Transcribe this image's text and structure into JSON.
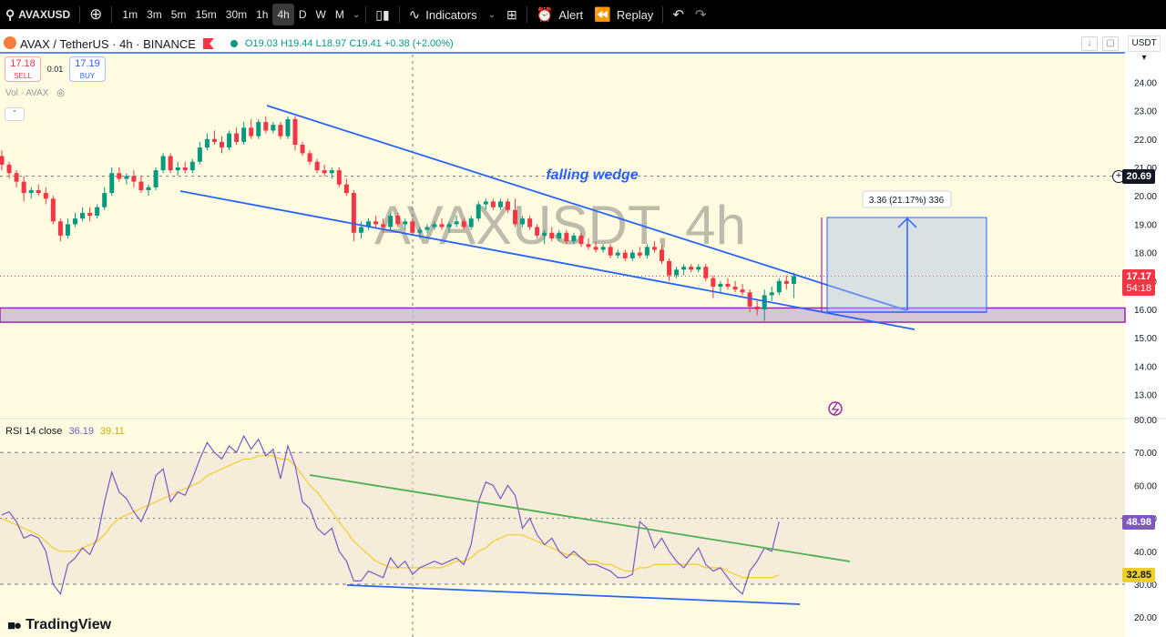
{
  "toolbar": {
    "symbol": "AVAXUSD",
    "intervals": [
      "1m",
      "3m",
      "5m",
      "15m",
      "30m",
      "1h",
      "4h",
      "D",
      "W",
      "M"
    ],
    "active_interval": "4h",
    "indicators_label": "Indicators",
    "alert_label": "Alert",
    "replay_label": "Replay"
  },
  "legend": {
    "title": "AVAX / TetherUS · 4h · BINANCE",
    "open": "O19.03",
    "high": "H19.44",
    "low": "L18.97",
    "close": "C19.41",
    "change": "+0.38 (+2.00%)"
  },
  "trade": {
    "sell_price": "17.18",
    "sell_label": "SELL",
    "spread": "0.01",
    "buy_price": "17.19",
    "buy_label": "BUY"
  },
  "volume_label": "Vol · AVAX",
  "currency_button": "USDT",
  "watermark": "AVAXUSDT, 4h",
  "annotation": {
    "pattern_label": "falling wedge",
    "measure_label": "3.36 (21.17%) 336"
  },
  "price_axis": {
    "ticks": [
      "24.00",
      "23.00",
      "22.00",
      "21.00",
      "20.00",
      "19.00",
      "18.00",
      "17.00",
      "16.00",
      "15.00",
      "14.00",
      "13.00"
    ],
    "crosshair_tag": "20.69",
    "last_price_tag": "17.17",
    "countdown_tag": "54:18"
  },
  "rsi": {
    "label": "RSI 14 close",
    "value_rsi": "36.19",
    "value_ma": "39.11",
    "ticks": [
      "80.00",
      "70.00",
      "60.00",
      "50.00",
      "40.00",
      "30.00",
      "20.00"
    ],
    "rsi_tag": "48.98",
    "ma_tag": "32.85"
  },
  "branding": "TradingView",
  "colors": {
    "up": "#089981",
    "down": "#f23645",
    "trendline": "#2962ff",
    "support": "#9c27b0",
    "rsi_line": "#7e57c2",
    "rsi_ma": "#f0cf29",
    "rsi_trend_upper": "#4caf50",
    "bg_fill": "#fffbe0"
  },
  "chart_data": {
    "type": "candlestick",
    "symbol": "AVAX / TetherUS",
    "timeframe": "4h",
    "ylim": [
      12.5,
      25.0
    ],
    "candles": [
      {
        "o": 21.4,
        "h": 21.6,
        "l": 20.9,
        "c": 21.1
      },
      {
        "o": 21.1,
        "h": 21.2,
        "l": 20.6,
        "c": 20.8
      },
      {
        "o": 20.8,
        "h": 20.9,
        "l": 20.3,
        "c": 20.5
      },
      {
        "o": 20.5,
        "h": 20.7,
        "l": 19.8,
        "c": 20.1
      },
      {
        "o": 20.1,
        "h": 20.3,
        "l": 19.9,
        "c": 20.2
      },
      {
        "o": 20.2,
        "h": 20.4,
        "l": 20.0,
        "c": 20.1
      },
      {
        "o": 20.1,
        "h": 20.3,
        "l": 19.7,
        "c": 19.9
      },
      {
        "o": 19.9,
        "h": 20.0,
        "l": 19.0,
        "c": 19.1
      },
      {
        "o": 19.1,
        "h": 19.2,
        "l": 18.4,
        "c": 18.6
      },
      {
        "o": 18.6,
        "h": 19.2,
        "l": 18.5,
        "c": 19.0
      },
      {
        "o": 19.0,
        "h": 19.4,
        "l": 18.9,
        "c": 19.2
      },
      {
        "o": 19.2,
        "h": 19.6,
        "l": 19.1,
        "c": 19.4
      },
      {
        "o": 19.4,
        "h": 19.6,
        "l": 19.1,
        "c": 19.3
      },
      {
        "o": 19.3,
        "h": 19.7,
        "l": 19.2,
        "c": 19.6
      },
      {
        "o": 19.6,
        "h": 20.3,
        "l": 19.5,
        "c": 20.1
      },
      {
        "o": 20.1,
        "h": 21.0,
        "l": 20.0,
        "c": 20.8
      },
      {
        "o": 20.8,
        "h": 21.0,
        "l": 20.5,
        "c": 20.6
      },
      {
        "o": 20.6,
        "h": 20.8,
        "l": 20.4,
        "c": 20.7
      },
      {
        "o": 20.7,
        "h": 20.9,
        "l": 20.3,
        "c": 20.5
      },
      {
        "o": 20.5,
        "h": 20.7,
        "l": 20.1,
        "c": 20.2
      },
      {
        "o": 20.2,
        "h": 20.4,
        "l": 20.0,
        "c": 20.3
      },
      {
        "o": 20.3,
        "h": 21.0,
        "l": 20.2,
        "c": 20.9
      },
      {
        "o": 20.9,
        "h": 21.5,
        "l": 20.8,
        "c": 21.4
      },
      {
        "o": 21.4,
        "h": 21.5,
        "l": 20.8,
        "c": 20.9
      },
      {
        "o": 20.9,
        "h": 21.2,
        "l": 20.7,
        "c": 21.0
      },
      {
        "o": 21.0,
        "h": 21.2,
        "l": 20.8,
        "c": 20.9
      },
      {
        "o": 20.9,
        "h": 21.3,
        "l": 20.8,
        "c": 21.2
      },
      {
        "o": 21.2,
        "h": 21.9,
        "l": 21.1,
        "c": 21.7
      },
      {
        "o": 21.7,
        "h": 22.2,
        "l": 21.6,
        "c": 22.0
      },
      {
        "o": 22.0,
        "h": 22.3,
        "l": 21.8,
        "c": 21.9
      },
      {
        "o": 21.9,
        "h": 22.1,
        "l": 21.5,
        "c": 21.7
      },
      {
        "o": 21.7,
        "h": 22.3,
        "l": 21.6,
        "c": 22.2
      },
      {
        "o": 22.2,
        "h": 22.4,
        "l": 21.8,
        "c": 21.9
      },
      {
        "o": 21.9,
        "h": 22.6,
        "l": 21.8,
        "c": 22.4
      },
      {
        "o": 22.4,
        "h": 22.7,
        "l": 22.0,
        "c": 22.1
      },
      {
        "o": 22.1,
        "h": 22.7,
        "l": 22.0,
        "c": 22.6
      },
      {
        "o": 22.6,
        "h": 22.8,
        "l": 22.2,
        "c": 22.3
      },
      {
        "o": 22.3,
        "h": 22.6,
        "l": 22.2,
        "c": 22.5
      },
      {
        "o": 22.5,
        "h": 22.6,
        "l": 22.0,
        "c": 22.1
      },
      {
        "o": 22.1,
        "h": 22.8,
        "l": 22.0,
        "c": 22.7
      },
      {
        "o": 22.7,
        "h": 22.8,
        "l": 21.6,
        "c": 21.8
      },
      {
        "o": 21.8,
        "h": 21.9,
        "l": 21.4,
        "c": 21.5
      },
      {
        "o": 21.5,
        "h": 21.6,
        "l": 21.1,
        "c": 21.2
      },
      {
        "o": 21.2,
        "h": 21.3,
        "l": 20.8,
        "c": 20.9
      },
      {
        "o": 20.9,
        "h": 21.1,
        "l": 20.7,
        "c": 20.8
      },
      {
        "o": 20.8,
        "h": 21.0,
        "l": 20.6,
        "c": 20.9
      },
      {
        "o": 20.9,
        "h": 21.0,
        "l": 20.3,
        "c": 20.4
      },
      {
        "o": 20.4,
        "h": 20.6,
        "l": 20.0,
        "c": 20.1
      },
      {
        "o": 20.1,
        "h": 20.2,
        "l": 18.4,
        "c": 18.7
      },
      {
        "o": 18.7,
        "h": 19.1,
        "l": 18.5,
        "c": 18.9
      },
      {
        "o": 18.9,
        "h": 19.2,
        "l": 18.8,
        "c": 19.1
      },
      {
        "o": 19.1,
        "h": 19.3,
        "l": 18.9,
        "c": 19.0
      },
      {
        "o": 19.0,
        "h": 19.2,
        "l": 18.7,
        "c": 18.9
      },
      {
        "o": 18.9,
        "h": 19.4,
        "l": 18.8,
        "c": 19.3
      },
      {
        "o": 19.3,
        "h": 19.4,
        "l": 18.9,
        "c": 19.0
      },
      {
        "o": 19.0,
        "h": 19.2,
        "l": 18.8,
        "c": 19.1
      },
      {
        "o": 19.1,
        "h": 19.2,
        "l": 18.6,
        "c": 18.7
      },
      {
        "o": 18.7,
        "h": 18.9,
        "l": 18.5,
        "c": 18.8
      },
      {
        "o": 18.8,
        "h": 19.0,
        "l": 18.7,
        "c": 18.9
      },
      {
        "o": 18.9,
        "h": 19.1,
        "l": 18.8,
        "c": 19.0
      },
      {
        "o": 19.0,
        "h": 19.2,
        "l": 18.8,
        "c": 18.9
      },
      {
        "o": 18.9,
        "h": 19.1,
        "l": 18.7,
        "c": 19.0
      },
      {
        "o": 19.0,
        "h": 19.3,
        "l": 18.9,
        "c": 19.1
      },
      {
        "o": 19.1,
        "h": 19.2,
        "l": 18.8,
        "c": 18.9
      },
      {
        "o": 18.9,
        "h": 19.3,
        "l": 18.8,
        "c": 19.2
      },
      {
        "o": 19.2,
        "h": 19.8,
        "l": 19.1,
        "c": 19.7
      },
      {
        "o": 19.7,
        "h": 19.9,
        "l": 19.5,
        "c": 19.8
      },
      {
        "o": 19.8,
        "h": 19.9,
        "l": 19.5,
        "c": 19.6
      },
      {
        "o": 19.6,
        "h": 19.9,
        "l": 19.5,
        "c": 19.8
      },
      {
        "o": 19.8,
        "h": 19.9,
        "l": 19.4,
        "c": 19.5
      },
      {
        "o": 19.5,
        "h": 19.9,
        "l": 18.9,
        "c": 19.0
      },
      {
        "o": 19.0,
        "h": 19.3,
        "l": 18.9,
        "c": 19.2
      },
      {
        "o": 19.2,
        "h": 19.3,
        "l": 18.8,
        "c": 18.9
      },
      {
        "o": 18.9,
        "h": 19.0,
        "l": 18.5,
        "c": 18.6
      },
      {
        "o": 18.6,
        "h": 18.8,
        "l": 18.3,
        "c": 18.7
      },
      {
        "o": 18.7,
        "h": 18.9,
        "l": 18.4,
        "c": 18.5
      },
      {
        "o": 18.5,
        "h": 18.8,
        "l": 18.4,
        "c": 18.7
      },
      {
        "o": 18.7,
        "h": 18.8,
        "l": 18.3,
        "c": 18.4
      },
      {
        "o": 18.4,
        "h": 18.7,
        "l": 18.3,
        "c": 18.6
      },
      {
        "o": 18.6,
        "h": 18.7,
        "l": 18.2,
        "c": 18.3
      },
      {
        "o": 18.3,
        "h": 18.5,
        "l": 18.1,
        "c": 18.2
      },
      {
        "o": 18.2,
        "h": 18.4,
        "l": 18.0,
        "c": 18.1
      },
      {
        "o": 18.1,
        "h": 18.3,
        "l": 18.0,
        "c": 18.2
      },
      {
        "o": 18.2,
        "h": 18.3,
        "l": 17.8,
        "c": 17.9
      },
      {
        "o": 17.9,
        "h": 18.1,
        "l": 17.8,
        "c": 18.0
      },
      {
        "o": 18.0,
        "h": 18.1,
        "l": 17.7,
        "c": 17.8
      },
      {
        "o": 17.8,
        "h": 18.1,
        "l": 17.7,
        "c": 18.0
      },
      {
        "o": 18.0,
        "h": 18.2,
        "l": 17.8,
        "c": 17.9
      },
      {
        "o": 17.9,
        "h": 18.3,
        "l": 17.8,
        "c": 18.2
      },
      {
        "o": 18.2,
        "h": 18.4,
        "l": 18.0,
        "c": 18.1
      },
      {
        "o": 18.1,
        "h": 18.3,
        "l": 17.6,
        "c": 17.7
      },
      {
        "o": 17.7,
        "h": 17.8,
        "l": 17.0,
        "c": 17.2
      },
      {
        "o": 17.2,
        "h": 17.5,
        "l": 17.1,
        "c": 17.4
      },
      {
        "o": 17.4,
        "h": 17.6,
        "l": 17.2,
        "c": 17.5
      },
      {
        "o": 17.5,
        "h": 17.6,
        "l": 17.3,
        "c": 17.4
      },
      {
        "o": 17.4,
        "h": 17.6,
        "l": 17.3,
        "c": 17.5
      },
      {
        "o": 17.5,
        "h": 17.6,
        "l": 17.0,
        "c": 17.1
      },
      {
        "o": 17.1,
        "h": 17.2,
        "l": 16.4,
        "c": 16.8
      },
      {
        "o": 16.8,
        "h": 17.0,
        "l": 16.6,
        "c": 16.9
      },
      {
        "o": 16.9,
        "h": 17.1,
        "l": 16.7,
        "c": 16.8
      },
      {
        "o": 16.8,
        "h": 17.0,
        "l": 16.6,
        "c": 16.7
      },
      {
        "o": 16.7,
        "h": 16.9,
        "l": 16.5,
        "c": 16.6
      },
      {
        "o": 16.6,
        "h": 16.7,
        "l": 15.9,
        "c": 16.1
      },
      {
        "o": 16.1,
        "h": 16.3,
        "l": 15.8,
        "c": 16.0
      },
      {
        "o": 16.0,
        "h": 16.7,
        "l": 15.6,
        "c": 16.5
      },
      {
        "o": 16.5,
        "h": 16.8,
        "l": 16.3,
        "c": 16.6
      },
      {
        "o": 16.6,
        "h": 17.1,
        "l": 16.5,
        "c": 17.0
      },
      {
        "o": 17.0,
        "h": 17.2,
        "l": 16.7,
        "c": 16.9
      },
      {
        "o": 16.9,
        "h": 17.3,
        "l": 16.4,
        "c": 17.17
      }
    ],
    "rsi": [
      51,
      52,
      49,
      44,
      45,
      44,
      40,
      30,
      27,
      36,
      38,
      41,
      39,
      44,
      55,
      64,
      58,
      56,
      52,
      49,
      54,
      63,
      65,
      55,
      58,
      57,
      62,
      68,
      73,
      70,
      68,
      72,
      70,
      75,
      71,
      74,
      69,
      71,
      62,
      72,
      66,
      55,
      53,
      47,
      45,
      47,
      40,
      37,
      31,
      31,
      34,
      33,
      32,
      38,
      35,
      37,
      33,
      35,
      36,
      37,
      36,
      37,
      38,
      36,
      42,
      55,
      61,
      60,
      56,
      60,
      57,
      47,
      50,
      45,
      42,
      44,
      40,
      38,
      40,
      38,
      36,
      36,
      35,
      34,
      32,
      32,
      33,
      49,
      47,
      41,
      44,
      40,
      37,
      35,
      38,
      41,
      36,
      34,
      35,
      32,
      29,
      27,
      34,
      37,
      41,
      40,
      48.98
    ],
    "rsi_ma": [
      50,
      49,
      48,
      47,
      46,
      45,
      43,
      41,
      40,
      40,
      40,
      41,
      42,
      43,
      45,
      48,
      50,
      51,
      52,
      53,
      54,
      55,
      56,
      57,
      58,
      59,
      60,
      61,
      63,
      64,
      65,
      66,
      67,
      68,
      68,
      69,
      69,
      69,
      68,
      68,
      66,
      63,
      60,
      58,
      55,
      52,
      49,
      46,
      43,
      41,
      39,
      37,
      36,
      35,
      35,
      35,
      35,
      35,
      35,
      35,
      35,
      36,
      37,
      37,
      38,
      40,
      41,
      43,
      44,
      45,
      45,
      45,
      44,
      43,
      42,
      41,
      40,
      39,
      39,
      38,
      37,
      37,
      36,
      36,
      35,
      34,
      34,
      35,
      35,
      36,
      36,
      36,
      36,
      36,
      36,
      36,
      35,
      35,
      35,
      34,
      33,
      32,
      32,
      32,
      32,
      32,
      32.85
    ],
    "rsi_ylim": [
      20,
      80
    ],
    "annotations": {
      "pattern": "falling wedge",
      "measure": "3.36 (21.17%) 336",
      "support_zone": [
        15.55,
        16.05
      ]
    }
  }
}
